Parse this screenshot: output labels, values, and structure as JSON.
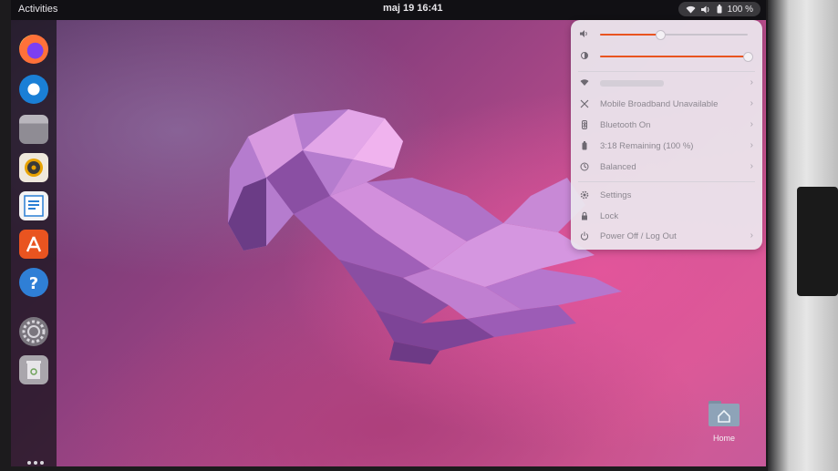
{
  "topbar": {
    "activities": "Activities",
    "clock": "maj 19  16:41",
    "battery": "100 %"
  },
  "dock": {
    "apps": [
      {
        "name": "firefox-icon"
      },
      {
        "name": "thunderbird-icon"
      },
      {
        "name": "files-icon"
      },
      {
        "name": "rhythmbox-icon"
      },
      {
        "name": "writer-icon"
      },
      {
        "name": "software-icon"
      },
      {
        "name": "help-icon"
      },
      {
        "name": "settings-icon"
      },
      {
        "name": "trash-icon"
      }
    ],
    "show_apps": "apps-grid-icon"
  },
  "system_menu": {
    "volume_level": 0.41,
    "brightness_level": 1.0,
    "items": [
      {
        "label": "Mobile Broadband Unavailable"
      },
      {
        "label": "Bluetooth On"
      },
      {
        "label": "3:18 Remaining (100 %)"
      },
      {
        "label": "Balanced"
      },
      {
        "label": "Settings"
      },
      {
        "label": "Lock"
      },
      {
        "label": "Power Off / Log Out"
      }
    ]
  },
  "desktop": {
    "home_label": "Home"
  },
  "colors": {
    "accent": "#e95420",
    "topbar": "#111014"
  }
}
